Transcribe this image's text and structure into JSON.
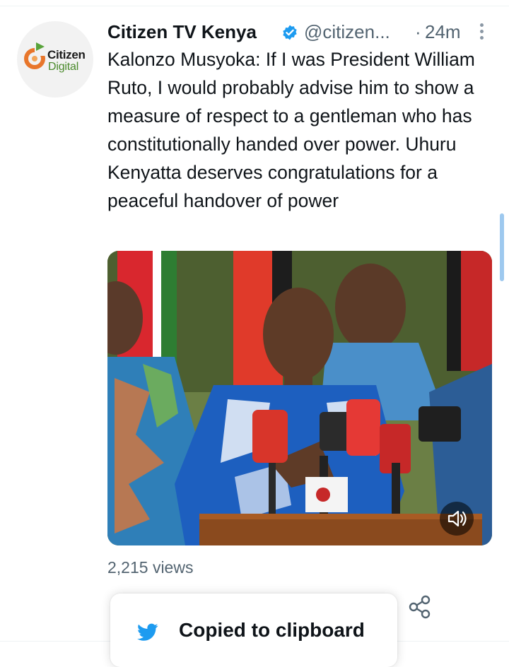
{
  "tweet": {
    "author_name": "Citizen TV Kenya",
    "handle": "@citizen...",
    "separator": "·",
    "time": "24m",
    "text": "Kalonzo Musyoka: If I was President William Ruto, I would probably advise him to show a measure of respect to a gentleman who has constitutionally handed over power. Uhuru Kenyatta deserves congratulations for a peaceful handover of power",
    "views": "2,215 views"
  },
  "avatar": {
    "logo_line1": "Citizen",
    "logo_line2": "Digital"
  },
  "toast": {
    "message": "Copied to clipboard"
  },
  "icons": {
    "verified": "verified-badge-icon",
    "more": "more-vertical-icon",
    "sound": "speaker-icon",
    "share": "share-icon",
    "toast": "bird-icon"
  },
  "colors": {
    "accent": "#1d9bf0",
    "secondary_text": "#536471",
    "primary_text": "#0f1419"
  }
}
